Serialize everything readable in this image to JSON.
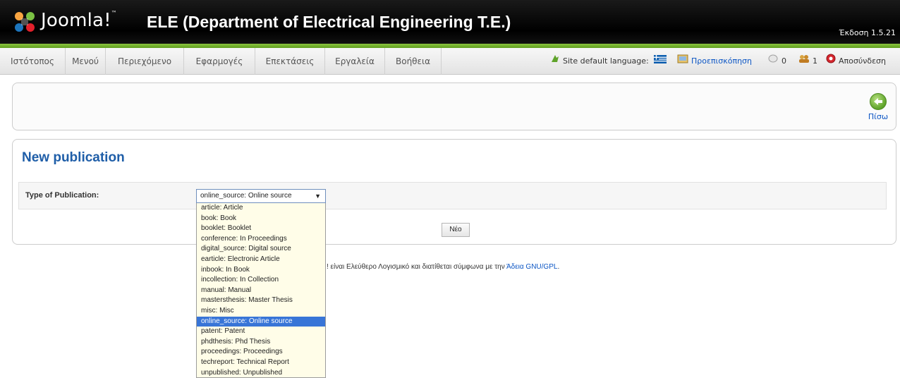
{
  "header": {
    "logo_text": "Joomla!",
    "logo_tm": "™",
    "site_title": "ELE (Department of Electrical Engineering T.E.)",
    "version": "Έκδοση 1.5.21"
  },
  "menu": {
    "items": [
      "Ιστότοπος",
      "Μενού",
      "Περιεχόμενο",
      "Εφαρμογές",
      "Επεκτάσεις",
      "Εργαλεία",
      "Βοήθεια"
    ]
  },
  "topright": {
    "language_label": "Site default language:",
    "preview_label": "Προεπισκόπηση",
    "messages_count": "0",
    "users_count": "1",
    "logout_label": "Αποσύνδεση"
  },
  "toolbar": {
    "back_label": "Πίσω"
  },
  "content": {
    "page_title": "New publication",
    "type_label": "Type of Publication:",
    "selected_value": "online_source: Online source",
    "new_button_label": "Νέο"
  },
  "footer": {
    "text_prefix": "! είναι Ελεύθερο Λογισμικό και διατίθεται σύμφωνα με την ",
    "license_link": "Άδεια GNU/GPL",
    "text_suffix": "."
  },
  "dropdown": {
    "options": [
      "article: Article",
      "book: Book",
      "booklet: Booklet",
      "conference: In Proceedings",
      "digital_source: Digital source",
      "earticle: Electronic Article",
      "inbook: In Book",
      "incollection: In Collection",
      "manual: Manual",
      "mastersthesis: Master Thesis",
      "misc: Misc",
      "online_source: Online source",
      "patent: Patent",
      "phdthesis: Phd Thesis",
      "proceedings: Proceedings",
      "techreport: Technical Report",
      "unpublished: Unpublished"
    ],
    "selected_index": 11
  },
  "colors": {
    "accent_green": "#7ab535",
    "title_blue": "#1f5ea8",
    "link_blue": "#0b55c4",
    "selected_blue": "#3875d7"
  }
}
